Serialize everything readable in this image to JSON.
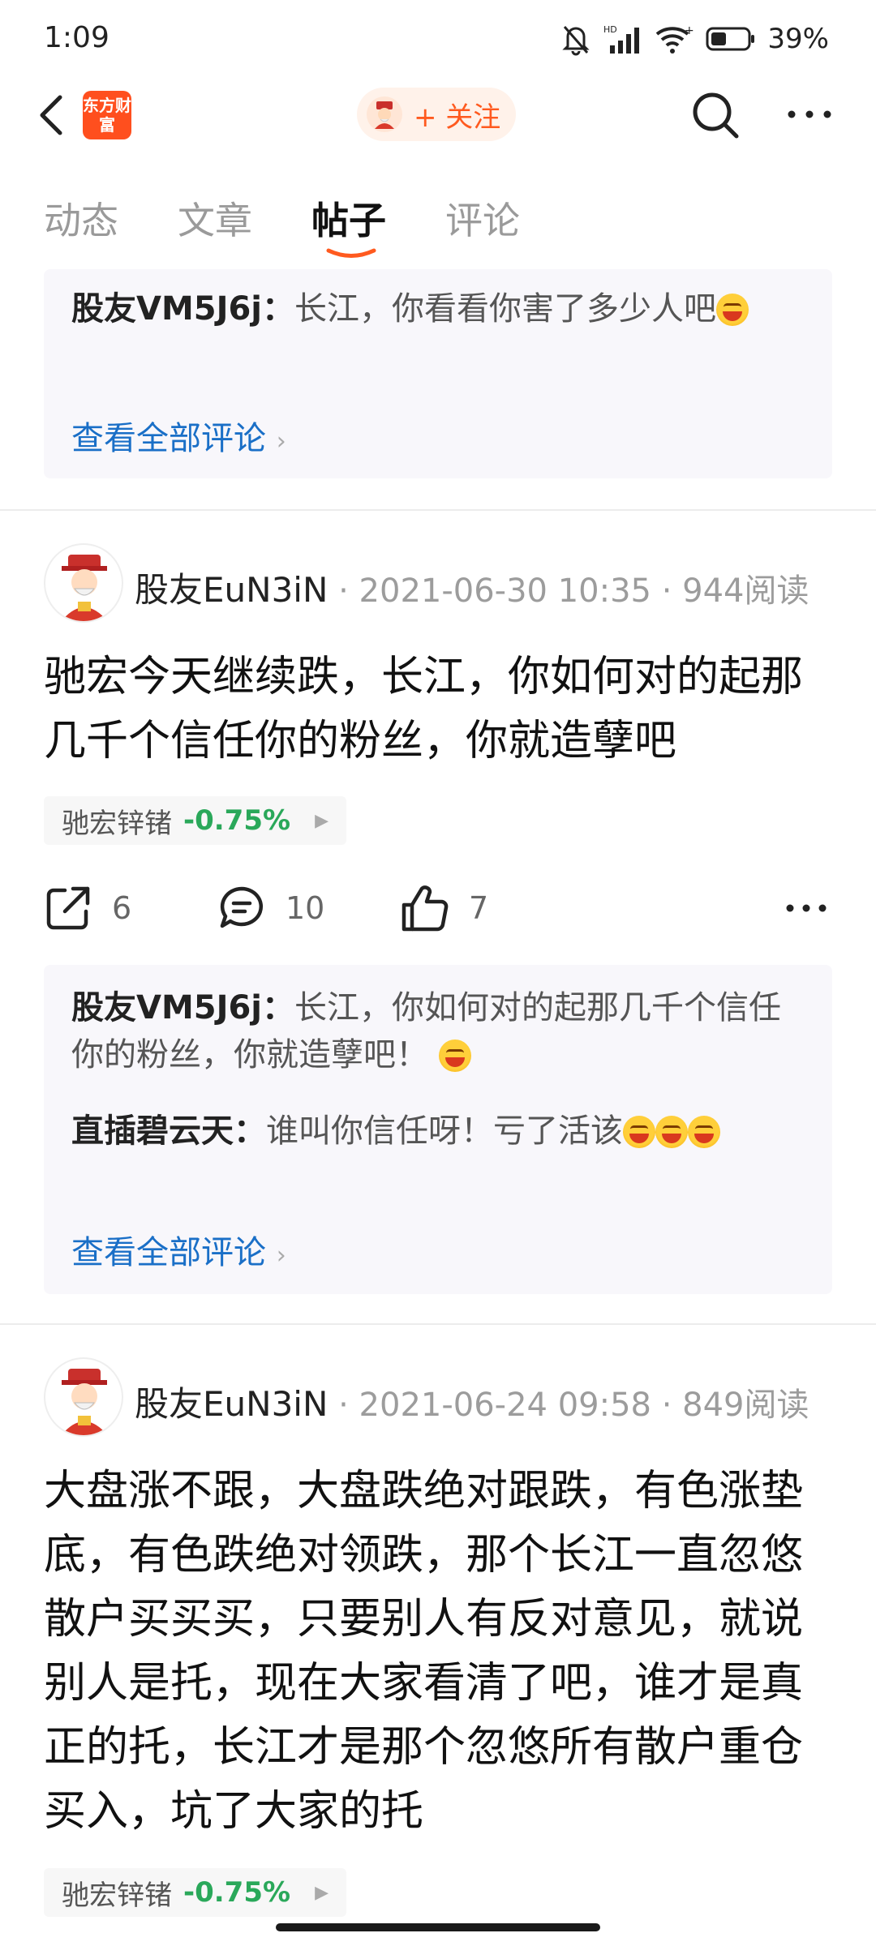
{
  "status_bar": {
    "time": "1:09",
    "battery": "39%"
  },
  "header": {
    "logo_text": "东方财富",
    "follow_label": "+ 关注"
  },
  "tabs": [
    {
      "label": "动态"
    },
    {
      "label": "文章"
    },
    {
      "label": "帖子",
      "active": true
    },
    {
      "label": "评论"
    }
  ],
  "top_comments": {
    "comments": [
      {
        "author": "股友VM5J6j：",
        "text": "长江，你看看你害了多少人吧"
      }
    ],
    "view_all": "查看全部评论"
  },
  "posts": [
    {
      "author": "股友EuN3iN",
      "date": "2021-06-30 10:35",
      "reads": "944阅读",
      "content": "驰宏今天继续跌，长江，你如何对的起那几千个信任你的粉丝，你就造孽吧",
      "stock": {
        "name": "驰宏锌锗",
        "change": "-0.75%"
      },
      "shares": "6",
      "comment_count": "10",
      "likes": "7",
      "comments": [
        {
          "author": "股友VM5J6j：",
          "text": "长江，你如何对的起那几千个信任你的粉丝，你就造孽吧！"
        },
        {
          "author": "直插碧云天：",
          "text": "谁叫你信任呀！亏了活该"
        }
      ],
      "view_all": "查看全部评论"
    },
    {
      "author": "股友EuN3iN",
      "date": "2021-06-24 09:58",
      "reads": "849阅读",
      "content": "大盘涨不跟，大盘跌绝对跟跌，有色涨垫底，有色跌绝对领跌，那个长江一直忽悠散户买买买，只要别人有反对意见，就说别人是托，现在大家看清了吧，谁才是真正的托，长江才是那个忽悠所有散户重仓买入，坑了大家的托",
      "stock": {
        "name": "驰宏锌锗",
        "change": "-0.75%"
      }
    }
  ],
  "colors": {
    "accent": "#ff5a1f",
    "link": "#1a6fc7",
    "stock_down": "#2aa85a"
  }
}
